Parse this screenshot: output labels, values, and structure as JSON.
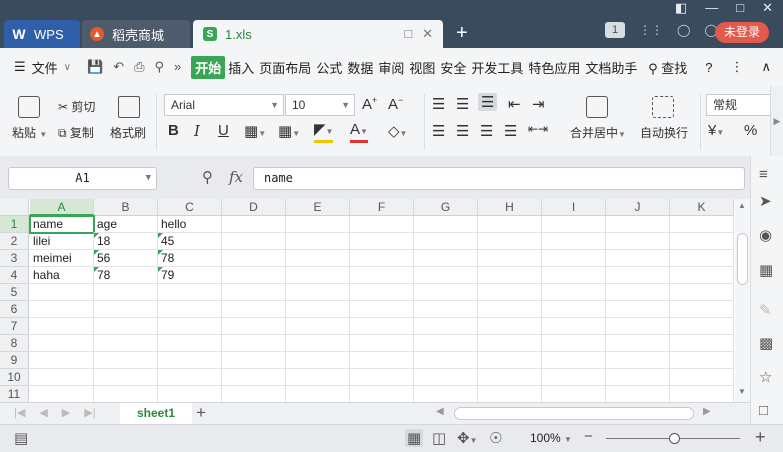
{
  "tabs": {
    "wps": "WPS",
    "store": "稻壳商城",
    "doc": "1.xls",
    "new_tab": "+"
  },
  "topbar": {
    "badge": "1",
    "login": "未登录"
  },
  "menubar": {
    "file": "文件",
    "items": [
      "开始",
      "插入",
      "页面布局",
      "公式",
      "数据",
      "审阅",
      "视图",
      "安全",
      "开发工具",
      "特色应用",
      "文档助手"
    ],
    "search": "查找"
  },
  "ribbon": {
    "paste": "粘贴",
    "cut": "剪切",
    "copy": "复制",
    "format_painter": "格式刷",
    "font_name": "Arial",
    "font_size": "10",
    "merge_center": "合并居中",
    "wrap_text": "自动换行",
    "number_format": "常规"
  },
  "formula_bar": {
    "name_box": "A1",
    "fx": "fx",
    "content": "name"
  },
  "grid": {
    "columns": [
      "A",
      "B",
      "C",
      "D",
      "E",
      "F",
      "G",
      "H",
      "I",
      "J",
      "K"
    ],
    "rows": [
      "1",
      "2",
      "3",
      "4",
      "5",
      "6",
      "7",
      "8",
      "9",
      "10",
      "11"
    ],
    "cells": [
      [
        "name",
        "age",
        "hello"
      ],
      [
        "lilei",
        "18",
        "45"
      ],
      [
        "meimei",
        "56",
        "78"
      ],
      [
        "haha",
        "78",
        "79"
      ]
    ]
  },
  "sheets": {
    "active": "sheet1",
    "add": "+"
  },
  "status": {
    "zoom": "100%",
    "zoom_out": "−",
    "zoom_in": "+"
  }
}
